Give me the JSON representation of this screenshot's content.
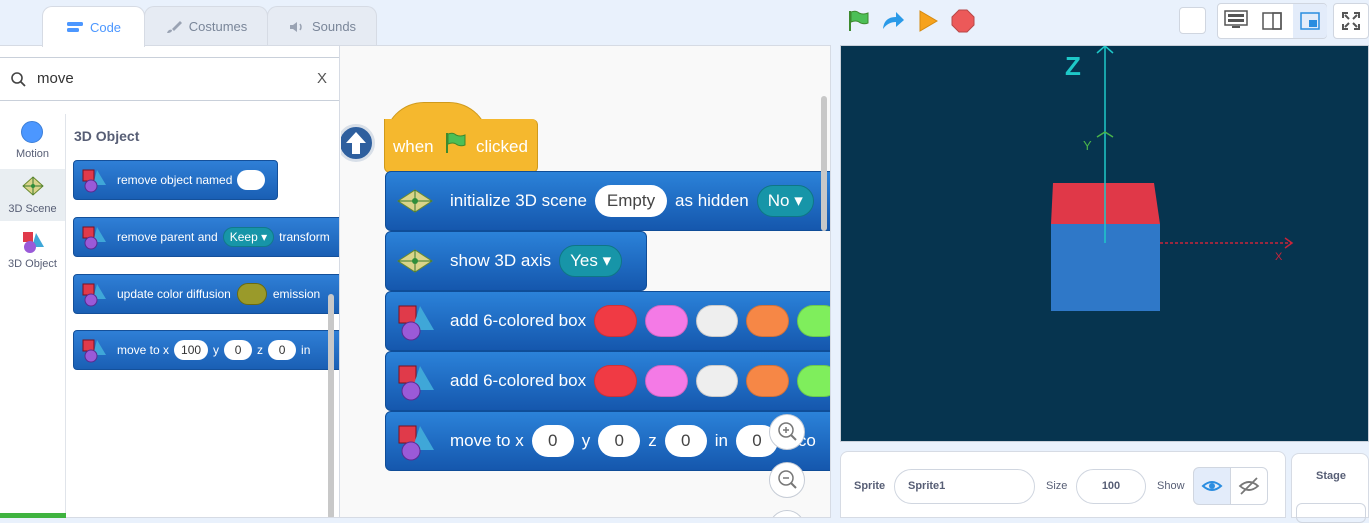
{
  "tabs": [
    {
      "label": "Code"
    },
    {
      "label": "Costumes"
    },
    {
      "label": "Sounds"
    }
  ],
  "search": {
    "value": "move",
    "clear": "X"
  },
  "categories": [
    {
      "label": "Motion",
      "color": "#4c97ff"
    },
    {
      "label": "3D Scene"
    },
    {
      "label": "3D Object"
    }
  ],
  "palette": {
    "heading": "3D Object",
    "blocks": {
      "remove_named": "remove object named",
      "remove_parent": "remove parent and",
      "remove_parent_opt": "Keep",
      "remove_parent_tail": "transform",
      "update_color": "update color diffusion",
      "update_color_tail": "emission",
      "move_to": "move to x",
      "move_x": "100",
      "move_y_lbl": "y",
      "move_y": "0",
      "move_z_lbl": "z",
      "move_z": "0",
      "move_in": "in"
    }
  },
  "script": {
    "hat_when": "when",
    "hat_clicked": "clicked",
    "init_label": "initialize 3D scene",
    "init_scene": "Empty",
    "init_hidden_lbl": "as hidden",
    "init_hidden": "No",
    "axis_label": "show 3D axis",
    "axis_value": "Yes",
    "box1_label": "add 6-colored box",
    "box2_label": "add 6-colored box",
    "box_colors": [
      "#f03a44",
      "#f47ae6",
      "#eeeeee",
      "#f68746",
      "#7fee5c"
    ],
    "move_label": "move to x",
    "move_x": "0",
    "move_y_lbl": "y",
    "move_y": "0",
    "move_z_lbl": "z",
    "move_z": "0",
    "move_in": "in",
    "move_secs": "0",
    "move_secs_lbl": "seco"
  },
  "stage_axes": {
    "z": "Z",
    "y": "Y",
    "x": "X"
  },
  "sprite_info": {
    "sprite_lbl": "Sprite",
    "sprite_name": "Sprite1",
    "size_lbl": "Size",
    "size_val": "100",
    "show_lbl": "Show"
  },
  "stage_panel": {
    "label": "Stage"
  },
  "colors": {
    "accent": "#4c97ff",
    "block": "#1a63b8",
    "stage_bg": "#06344f"
  }
}
